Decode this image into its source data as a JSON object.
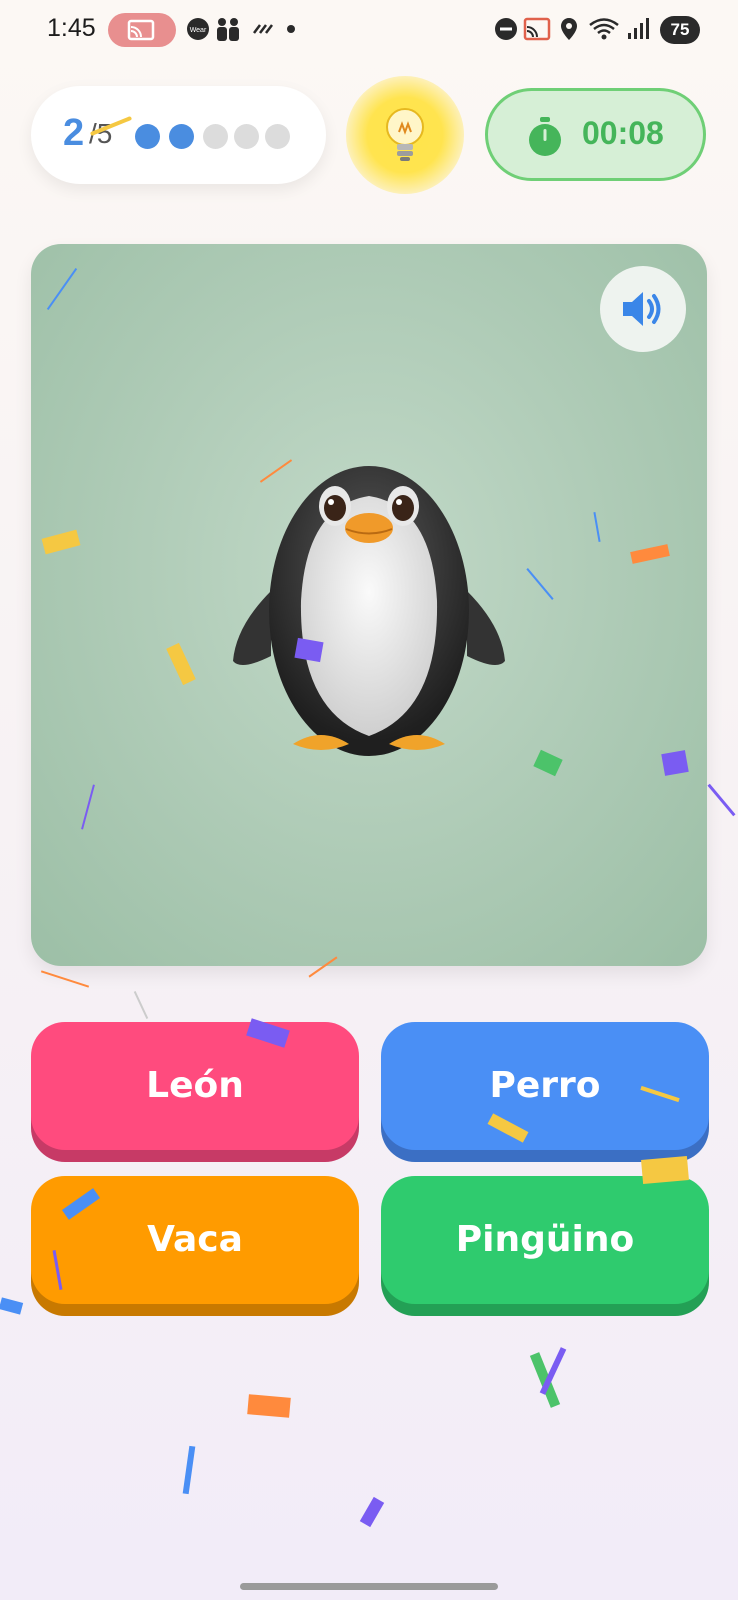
{
  "status_bar": {
    "time": "1:45",
    "battery": "75",
    "icons": [
      "cast-icon",
      "wear-os-icon",
      "family-icon",
      "sync-icon",
      "dot-icon",
      "do-not-disturb-icon",
      "cast-icon",
      "location-icon",
      "wifi-icon",
      "signal-icon",
      "battery-icon"
    ]
  },
  "progress": {
    "current": "2",
    "total": "/5",
    "dots": [
      {
        "state": "done",
        "color": "#4a8de0"
      },
      {
        "state": "done",
        "color": "#4a8de0"
      },
      {
        "state": "todo",
        "color": "#dcdcdc"
      },
      {
        "state": "todo",
        "color": "#dcdcdc"
      },
      {
        "state": "todo",
        "color": "#dcdcdc"
      }
    ]
  },
  "hint": {
    "icon": "lightbulb-icon"
  },
  "timer": {
    "icon": "stopwatch-icon",
    "value": "00:08"
  },
  "question": {
    "image": "penguin",
    "sound_icon": "speaker-icon"
  },
  "answers": [
    {
      "label": "León",
      "color": "#ff4b7e"
    },
    {
      "label": "Perro",
      "color": "#4a8ff5"
    },
    {
      "label": "Vaca",
      "color": "#ff9b00"
    },
    {
      "label": "Pingüino",
      "color": "#2fcb6e"
    }
  ]
}
